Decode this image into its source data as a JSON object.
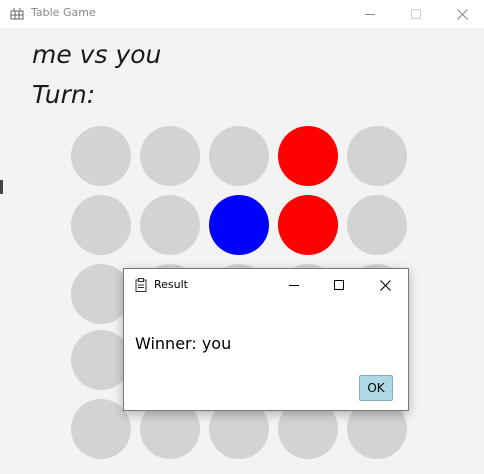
{
  "window": {
    "title": "Table Game",
    "background": "#f3f3f3"
  },
  "icons": {
    "app": "table-game-icon",
    "minimize": "minimize-icon",
    "maximize": "maximize-icon",
    "close": "close-icon",
    "dialog": "clipboard-icon"
  },
  "game": {
    "players": "me vs you",
    "turn_label": "Turn:",
    "colors": {
      "empty": "#d3d3d3",
      "red": "#ff0000",
      "blue": "#0000ff"
    },
    "board": [
      [
        "empty",
        "empty",
        "empty",
        "red",
        "empty"
      ],
      [
        "empty",
        "empty",
        "blue",
        "red",
        "empty"
      ],
      [
        "empty",
        "empty",
        "empty",
        "empty",
        "empty"
      ],
      [
        "empty",
        "empty",
        "empty",
        "empty",
        "empty"
      ],
      [
        "empty",
        "empty",
        "empty",
        "empty",
        "empty"
      ]
    ]
  },
  "dialog": {
    "title": "Result",
    "message": "Winner: you",
    "ok_label": "OK",
    "ok_color": "#add8e6"
  }
}
